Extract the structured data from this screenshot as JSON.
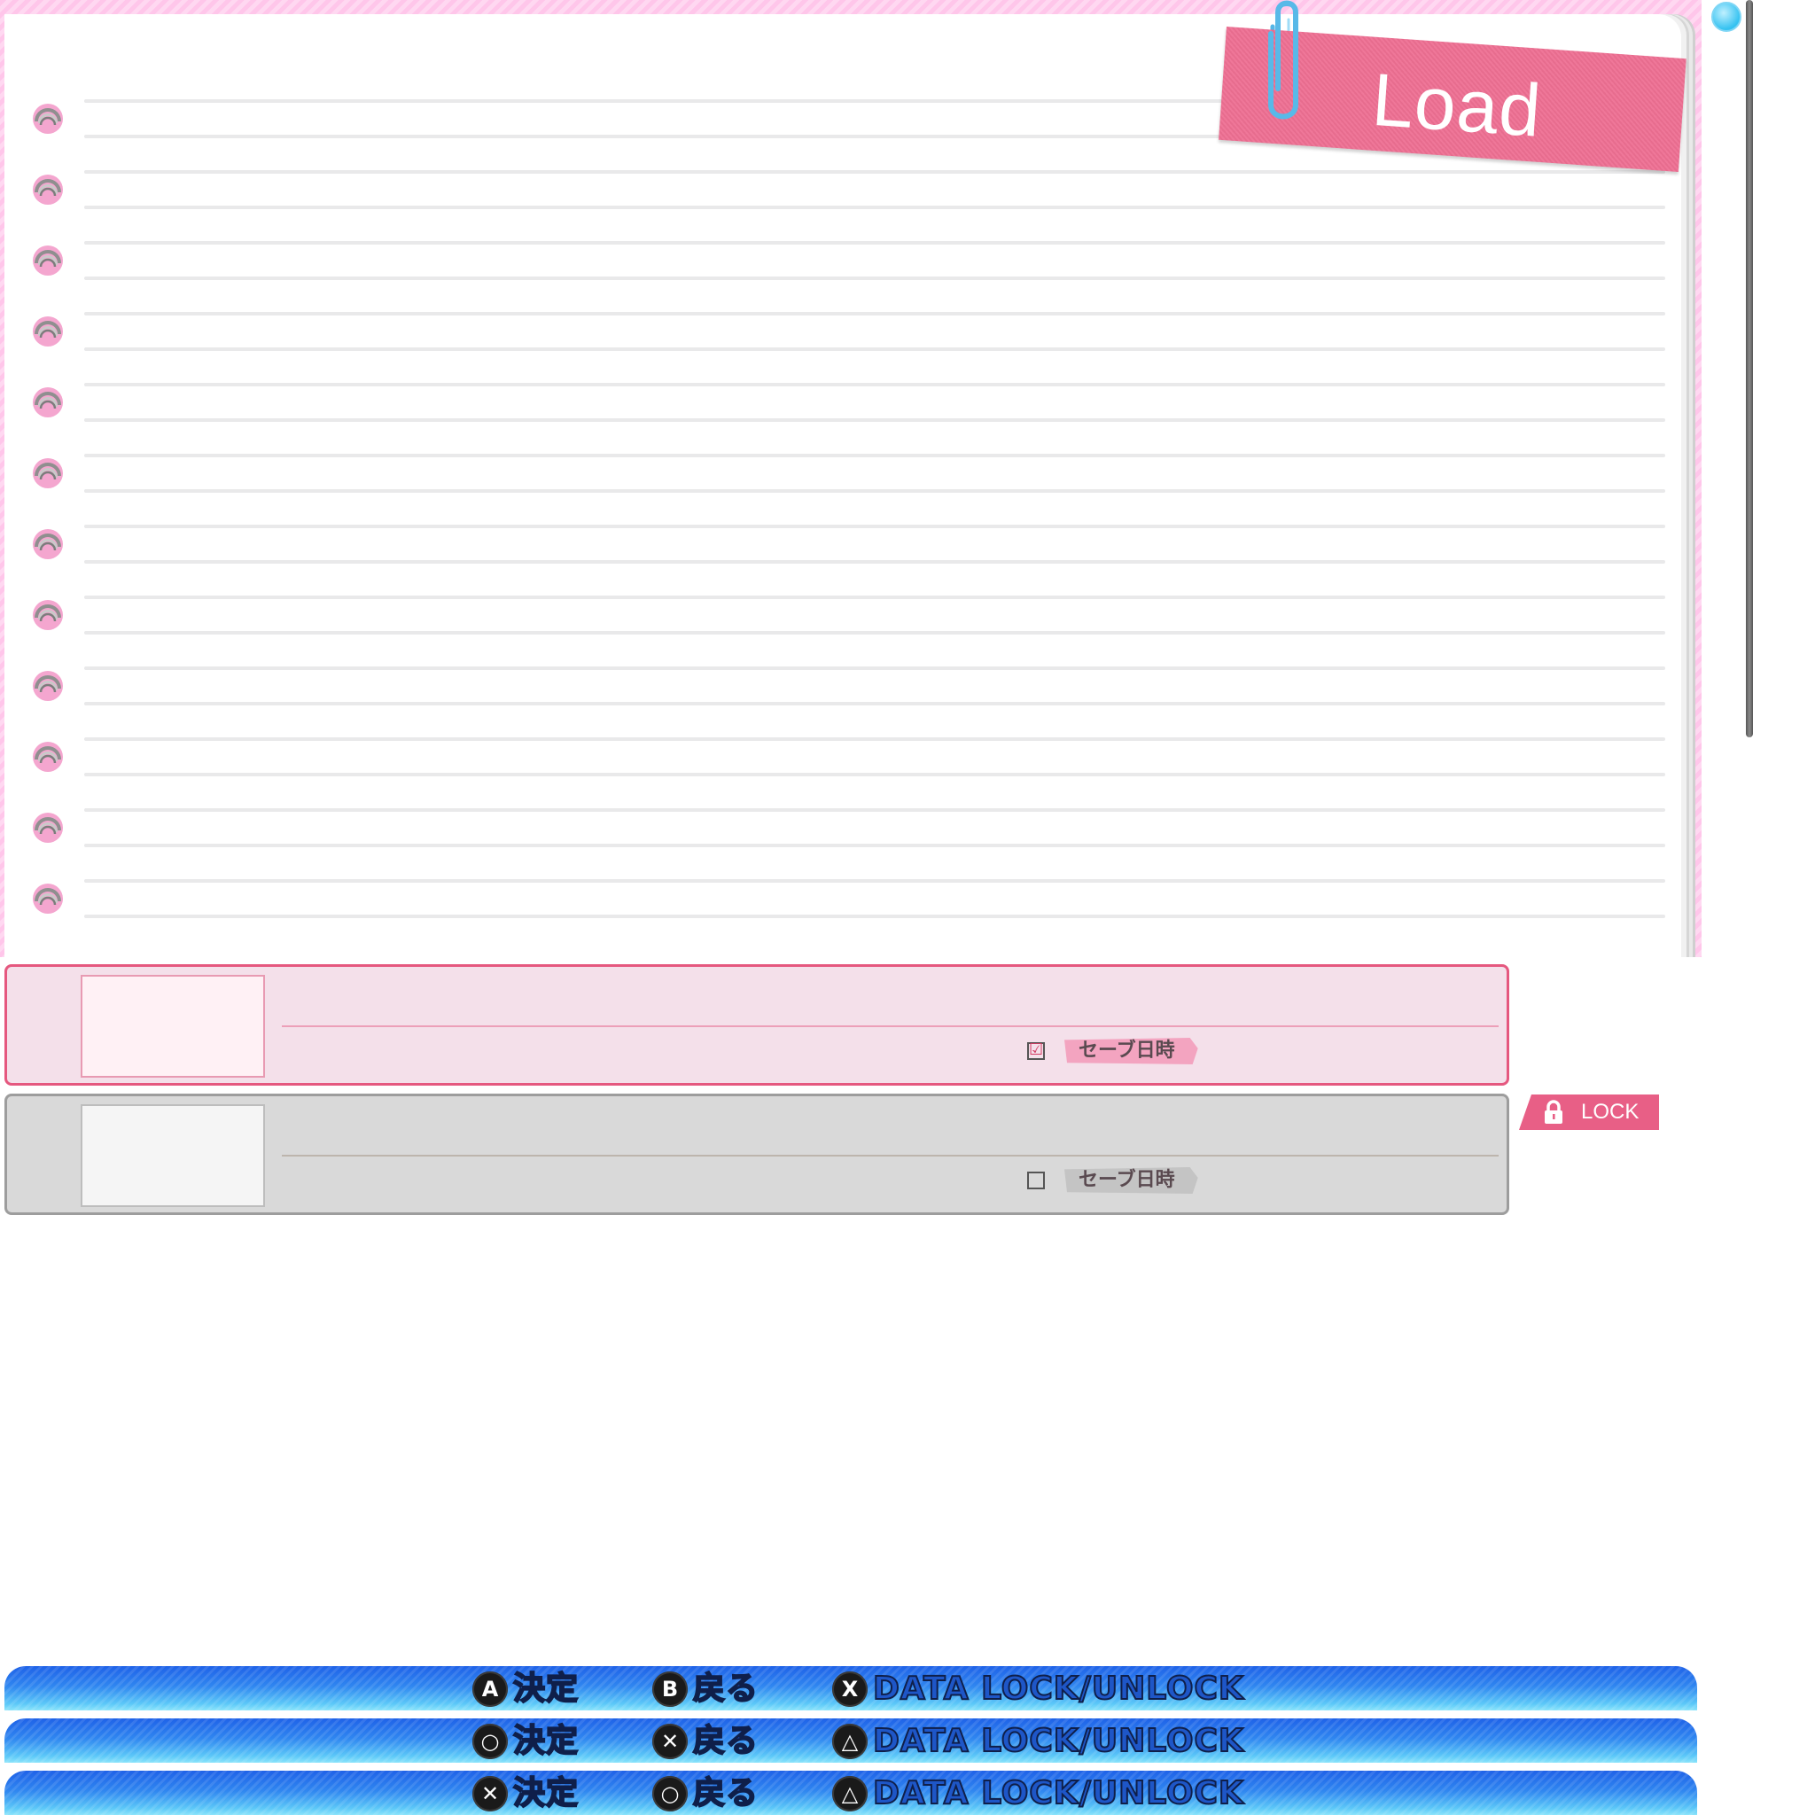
{
  "screen": {
    "title": "Load"
  },
  "accent_colors": {
    "pink": "#ee6f93",
    "scroll_knob": "#35c2f1",
    "bar_blue": "#2f86f0"
  },
  "slots": [
    {
      "state": "selected",
      "checked": true,
      "check_mark": "☑",
      "date_label": "セーブ日時",
      "locked": false
    },
    {
      "state": "normal",
      "checked": false,
      "check_mark": "",
      "date_label": "セーブ日時",
      "locked": true
    }
  ],
  "lock_badge": {
    "label": "LOCK",
    "icon": "lock-icon"
  },
  "button_bars": [
    {
      "hints": [
        {
          "glyph": "A",
          "glyph_icon": "a-button-icon",
          "label": "決定"
        },
        {
          "glyph": "B",
          "glyph_icon": "b-button-icon",
          "label": "戻る"
        },
        {
          "glyph": "X",
          "glyph_icon": "x-button-icon",
          "label": "DATA LOCK/UNLOCK"
        }
      ]
    },
    {
      "hints": [
        {
          "glyph": "○",
          "glyph_icon": "circle-button-icon",
          "label": "決定"
        },
        {
          "glyph": "✕",
          "glyph_icon": "cross-button-icon",
          "label": "戻る"
        },
        {
          "glyph": "△",
          "glyph_icon": "triangle-button-icon",
          "label": "DATA LOCK/UNLOCK"
        }
      ]
    },
    {
      "hints": [
        {
          "glyph": "✕",
          "glyph_icon": "cross-button-icon",
          "label": "決定"
        },
        {
          "glyph": "○",
          "glyph_icon": "circle-button-icon",
          "label": "戻る"
        },
        {
          "glyph": "△",
          "glyph_icon": "triangle-button-icon",
          "label": "DATA LOCK/UNLOCK"
        }
      ]
    }
  ]
}
